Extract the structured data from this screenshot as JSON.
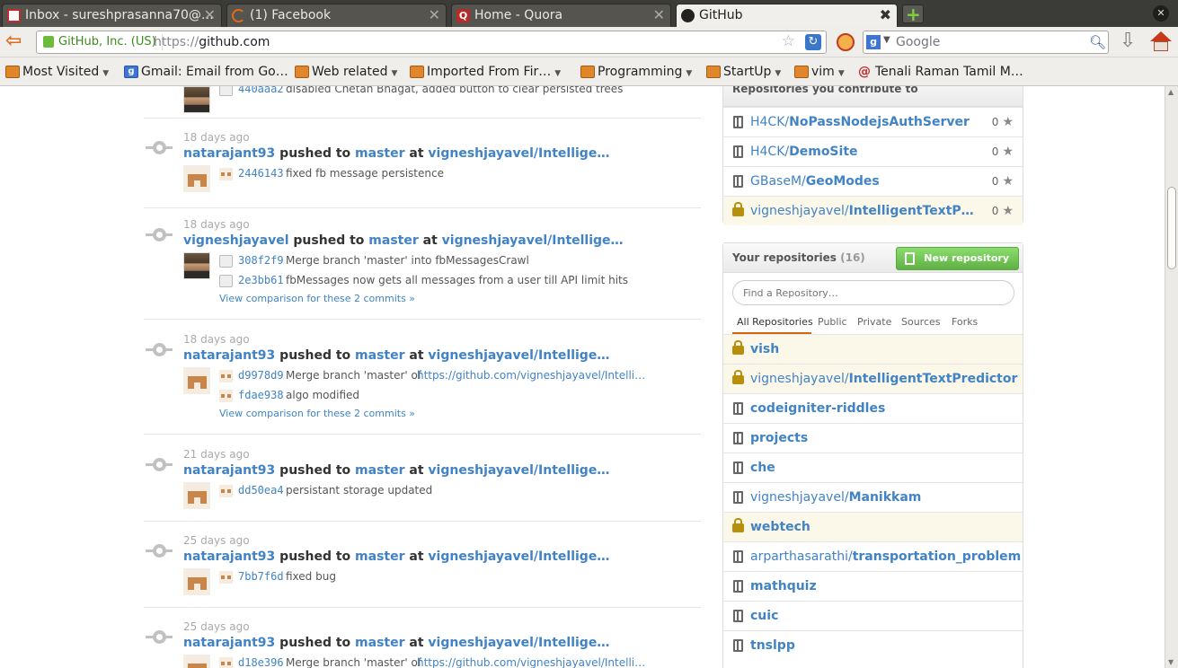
{
  "browser": {
    "tabs": [
      {
        "label": "Inbox - sureshprasanna70@…",
        "icon": "gmail-icon",
        "color": "#c62b2b"
      },
      {
        "label": "(1) Facebook",
        "icon": "loading-icon",
        "color": "#e06a1c"
      },
      {
        "label": "Home - Quora",
        "icon": "quora-icon",
        "color": "#b92b27"
      },
      {
        "label": "GitHub",
        "icon": "github-icon",
        "color": "#222222"
      }
    ],
    "site_identity": "GitHub, Inc. (US)",
    "url_proto": "https://",
    "url_host": "github.com",
    "search_placeholder": "Google",
    "bookmarks": [
      {
        "label": "Most Visited",
        "dropdown": true,
        "icon": "folder"
      },
      {
        "label": "Gmail: Email from Go…",
        "dropdown": false,
        "icon": "google"
      },
      {
        "label": "Web related",
        "dropdown": true,
        "icon": "folder"
      },
      {
        "label": "Imported From Fir…",
        "dropdown": true,
        "icon": "folder"
      },
      {
        "label": "Programming",
        "dropdown": true,
        "icon": "folder"
      },
      {
        "label": "StartUp",
        "dropdown": true,
        "icon": "folder"
      },
      {
        "label": "vim",
        "dropdown": true,
        "icon": "folder"
      },
      {
        "label": "Tenali Raman Tamil M…",
        "dropdown": false,
        "icon": "tenali"
      }
    ]
  },
  "feed": {
    "partial_top": {
      "sha": "440aaa2",
      "message": "disabled Chetan Bhagat, added button to clear persisted trees"
    },
    "pushed_to": "pushed to",
    "at": "at",
    "events": [
      {
        "time": "18 days ago",
        "user": "natarajant93",
        "branch": "master",
        "repo": "vigneshjayavel/Intellige…",
        "commits": [
          {
            "sha": "2446143",
            "message": "fixed fb message persistence",
            "link": ""
          }
        ],
        "compare": ""
      },
      {
        "time": "18 days ago",
        "user": "vigneshjayavel",
        "branch": "master",
        "repo": "vigneshjayavel/Intellige…",
        "commits": [
          {
            "sha": "308f2f9",
            "message": "Merge branch 'master' into fbMessagesCrawl",
            "link": ""
          },
          {
            "sha": "2e3bb61",
            "message": "fbMessages now gets all messages from a user till API limit hits",
            "link": ""
          }
        ],
        "compare": "View comparison for these 2 commits »"
      },
      {
        "time": "18 days ago",
        "user": "natarajant93",
        "branch": "master",
        "repo": "vigneshjayavel/Intellige…",
        "commits": [
          {
            "sha": "d9978d9",
            "message": "Merge branch 'master' of",
            "link": "https://github.com/vigneshjayavel/Intelli…"
          },
          {
            "sha": "fdae938",
            "message": "algo modified",
            "link": ""
          }
        ],
        "compare": "View comparison for these 2 commits »"
      },
      {
        "time": "21 days ago",
        "user": "natarajant93",
        "branch": "master",
        "repo": "vigneshjayavel/Intellige…",
        "commits": [
          {
            "sha": "dd50ea4",
            "message": "persistant storage updated",
            "link": ""
          }
        ],
        "compare": ""
      },
      {
        "time": "25 days ago",
        "user": "natarajant93",
        "branch": "master",
        "repo": "vigneshjayavel/Intellige…",
        "commits": [
          {
            "sha": "7bb7f6d",
            "message": "fixed bug",
            "link": ""
          }
        ],
        "compare": ""
      },
      {
        "time": "25 days ago",
        "user": "natarajant93",
        "branch": "master",
        "repo": "vigneshjayavel/Intellige…",
        "commits": [
          {
            "sha": "d18e396",
            "message": "Merge branch 'master' of",
            "link": "https://github.com/vigneshjayavel/Intelli…"
          }
        ],
        "compare": ""
      }
    ]
  },
  "contrib": {
    "title": "Repositories you contribute to",
    "repos": [
      {
        "owner": "H4CK/",
        "name": "NoPassNodejsAuthServer",
        "stars": "0",
        "private": false
      },
      {
        "owner": "H4CK/",
        "name": "DemoSite",
        "stars": "0",
        "private": false
      },
      {
        "owner": "GBaseM/",
        "name": "GeoModes",
        "stars": "0",
        "private": false
      },
      {
        "owner": "vigneshjayavel/",
        "name": "IntelligentTextP…",
        "stars": "0",
        "private": true
      }
    ]
  },
  "yours": {
    "title": "Your repositories",
    "count": "(16)",
    "new_button": "New repository",
    "find_placeholder": "Find a Repository…",
    "filters": [
      "All Repositories",
      "Public",
      "Private",
      "Sources",
      "Forks"
    ],
    "repos": [
      {
        "owner": "",
        "name": "vish",
        "private": true
      },
      {
        "owner": "vigneshjayavel/",
        "name": "IntelligentTextPredictor",
        "private": true
      },
      {
        "owner": "",
        "name": "codeigniter-riddles",
        "private": false
      },
      {
        "owner": "",
        "name": "projects",
        "private": false
      },
      {
        "owner": "",
        "name": "che",
        "private": false
      },
      {
        "owner": "vigneshjayavel/",
        "name": "Manikkam",
        "private": false
      },
      {
        "owner": "",
        "name": "webtech",
        "private": true
      },
      {
        "owner": "arparthasarathi/",
        "name": "transportation_problem",
        "private": false
      },
      {
        "owner": "",
        "name": "mathquiz",
        "private": false
      },
      {
        "owner": "",
        "name": "cuic",
        "private": false
      },
      {
        "owner": "",
        "name": "tnslpp",
        "private": false
      }
    ]
  }
}
